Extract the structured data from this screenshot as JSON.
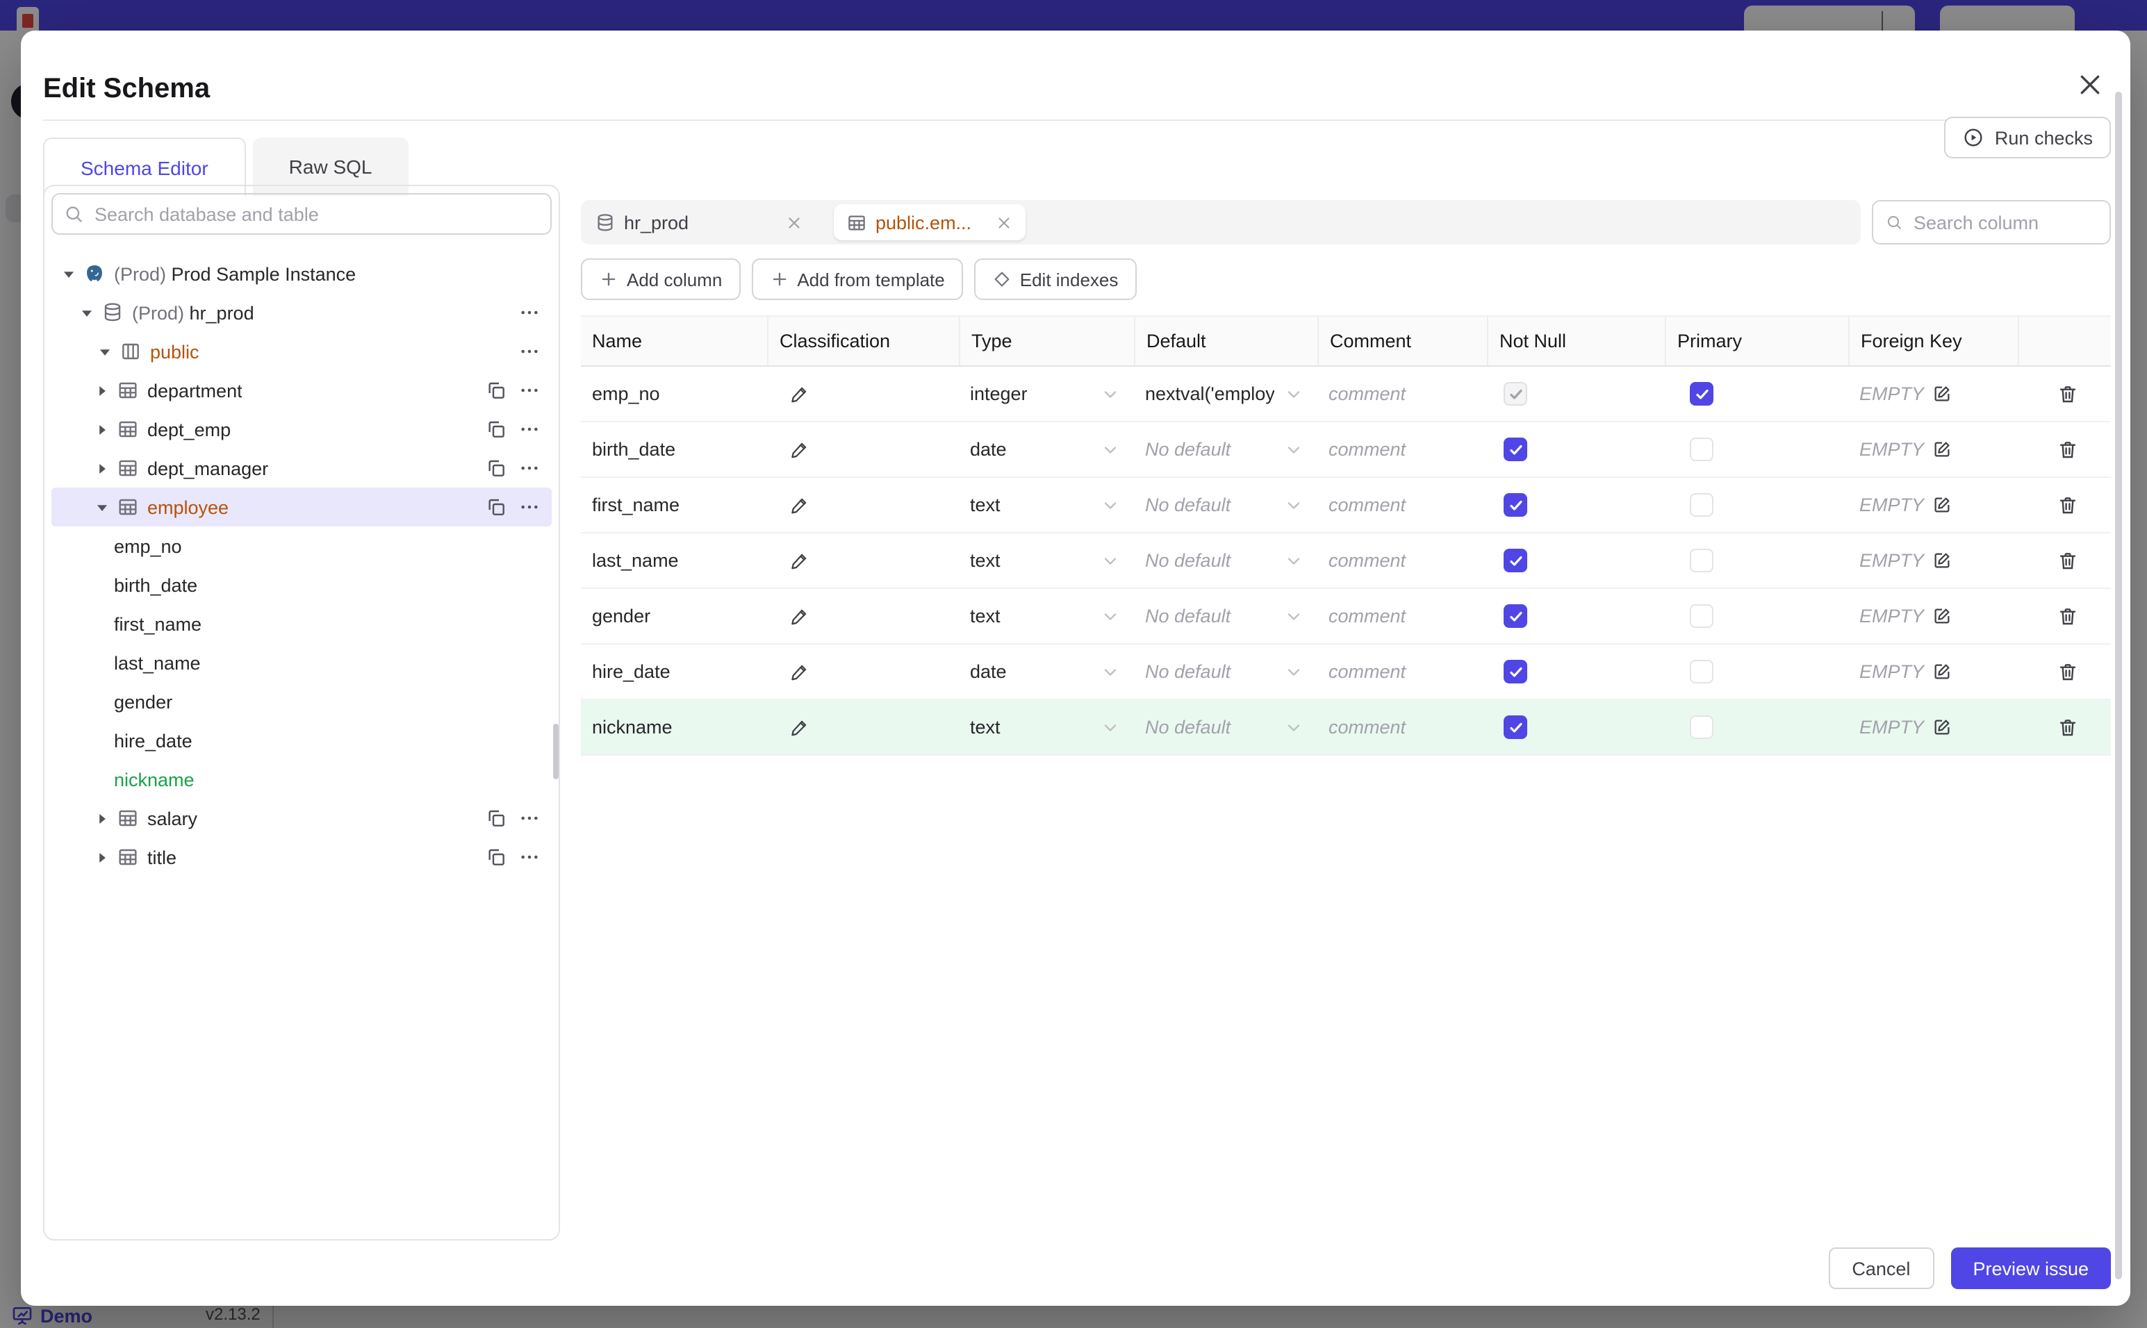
{
  "page": {
    "demo_label": "Demo",
    "version": "v2.13.2",
    "accent_color": "#4f46e5"
  },
  "modal": {
    "title": "Edit Schema",
    "tabs": [
      {
        "label": "Schema Editor",
        "active": true
      },
      {
        "label": "Raw SQL",
        "active": false
      }
    ],
    "run_checks_label": "Run checks",
    "footer": {
      "cancel_label": "Cancel",
      "preview_label": "Preview issue"
    }
  },
  "sidebar": {
    "search_placeholder": "Search database and table",
    "tree": [
      {
        "level": 0,
        "icon": "postgres",
        "caret": "down",
        "prefix": "(Prod) ",
        "label": "Prod Sample Instance"
      },
      {
        "level": 1,
        "icon": "database",
        "caret": "down",
        "prefix": "(Prod) ",
        "label": "hr_prod",
        "ellipsis": true
      },
      {
        "level": 2,
        "icon": "schema",
        "caret": "down",
        "label": "public",
        "color": "amber",
        "ellipsis": true
      },
      {
        "level": 3,
        "icon": "table",
        "caret": "right",
        "label": "department",
        "copy": true,
        "ellipsis": true
      },
      {
        "level": 3,
        "icon": "table",
        "caret": "right",
        "label": "dept_emp",
        "copy": true,
        "ellipsis": true
      },
      {
        "level": 3,
        "icon": "table",
        "caret": "right",
        "label": "dept_manager",
        "copy": true,
        "ellipsis": true
      },
      {
        "level": 3,
        "icon": "table",
        "caret": "down",
        "label": "employee",
        "color": "amber",
        "selected": true,
        "copy": true,
        "ellipsis": true
      },
      {
        "level": 4,
        "label": "emp_no"
      },
      {
        "level": 4,
        "label": "birth_date"
      },
      {
        "level": 4,
        "label": "first_name"
      },
      {
        "level": 4,
        "label": "last_name"
      },
      {
        "level": 4,
        "label": "gender"
      },
      {
        "level": 4,
        "label": "hire_date"
      },
      {
        "level": 4,
        "label": "nickname",
        "color": "green"
      },
      {
        "level": 3,
        "icon": "table",
        "caret": "right",
        "label": "salary",
        "copy": true,
        "ellipsis": true
      },
      {
        "level": 3,
        "icon": "table",
        "caret": "right",
        "label": "title",
        "copy": true,
        "ellipsis": true
      }
    ]
  },
  "editor": {
    "tabs": [
      {
        "label": "hr_prod",
        "icon": "database",
        "active": false
      },
      {
        "label": "public.em...",
        "icon": "table",
        "active": true,
        "color": "amber"
      }
    ],
    "search_placeholder": "Search column",
    "actions": [
      {
        "label": "Add column",
        "icon": "plus"
      },
      {
        "label": "Add from template",
        "icon": "plus"
      },
      {
        "label": "Edit indexes",
        "icon": "diamond"
      }
    ],
    "table": {
      "headers": [
        "Name",
        "Classification",
        "Type",
        "Default",
        "Comment",
        "Not Null",
        "Primary",
        "Foreign Key"
      ],
      "comment_placeholder": "comment",
      "rows": [
        {
          "name": "emp_no",
          "type": "integer",
          "default": "nextval('employ",
          "default_muted": false,
          "not_null": {
            "checked": true,
            "disabled": true
          },
          "primary": true,
          "foreign_key": "EMPTY",
          "added": false
        },
        {
          "name": "birth_date",
          "type": "date",
          "default": "No default",
          "default_muted": true,
          "not_null": {
            "checked": true,
            "disabled": false
          },
          "primary": false,
          "foreign_key": "EMPTY",
          "added": false
        },
        {
          "name": "first_name",
          "type": "text",
          "default": "No default",
          "default_muted": true,
          "not_null": {
            "checked": true,
            "disabled": false
          },
          "primary": false,
          "foreign_key": "EMPTY",
          "added": false
        },
        {
          "name": "last_name",
          "type": "text",
          "default": "No default",
          "default_muted": true,
          "not_null": {
            "checked": true,
            "disabled": false
          },
          "primary": false,
          "foreign_key": "EMPTY",
          "added": false
        },
        {
          "name": "gender",
          "type": "text",
          "default": "No default",
          "default_muted": true,
          "not_null": {
            "checked": true,
            "disabled": false
          },
          "primary": false,
          "foreign_key": "EMPTY",
          "added": false
        },
        {
          "name": "hire_date",
          "type": "date",
          "default": "No default",
          "default_muted": true,
          "not_null": {
            "checked": true,
            "disabled": false
          },
          "primary": false,
          "foreign_key": "EMPTY",
          "added": false
        },
        {
          "name": "nickname",
          "type": "text",
          "default": "No default",
          "default_muted": true,
          "not_null": {
            "checked": true,
            "disabled": false
          },
          "primary": false,
          "foreign_key": "EMPTY",
          "added": true
        }
      ]
    }
  }
}
